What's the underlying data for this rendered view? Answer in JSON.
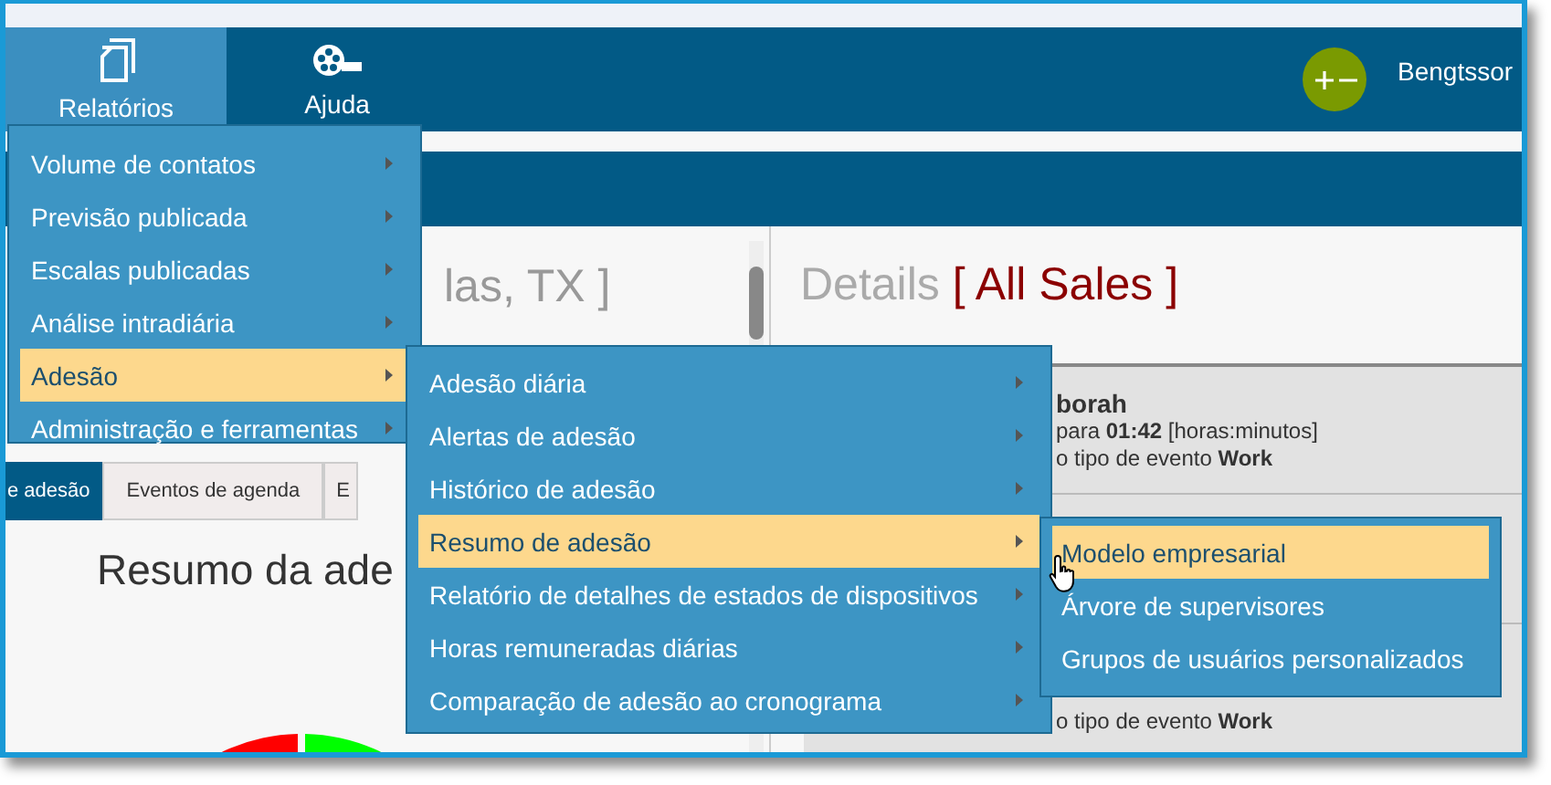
{
  "header": {
    "nav": [
      {
        "label": "Relatórios",
        "selected": true
      },
      {
        "label": "Ajuda",
        "selected": false
      }
    ],
    "user": "Bengtssor"
  },
  "left_panel": {
    "title_fragment": "las, TX ]",
    "tabs": [
      {
        "label": "e adesão",
        "selected": true
      },
      {
        "label": "Eventos de agenda",
        "selected": false
      },
      {
        "label": "E",
        "selected": false
      }
    ],
    "heading": "Resumo da ade"
  },
  "right_panel": {
    "title": "Details",
    "filter": "[ All Sales ]",
    "cards": [
      {
        "lines": [
          "borah",
          "para **01:42** [horas:minutos]",
          "o tipo de evento **Work**"
        ]
      },
      {
        "lines": [
          "o tipo de evento **Work**"
        ]
      }
    ]
  },
  "menu": {
    "items": [
      {
        "label": "Volume de contatos",
        "arrow": true,
        "selected": false
      },
      {
        "label": "Previsão publicada",
        "arrow": true,
        "selected": false
      },
      {
        "label": "Escalas publicadas",
        "arrow": true,
        "selected": false
      },
      {
        "label": "Análise intradiária",
        "arrow": true,
        "selected": false
      },
      {
        "label": "Adesão",
        "arrow": true,
        "selected": true,
        "children": [
          {
            "label": "Adesão diária",
            "arrow": true,
            "selected": false
          },
          {
            "label": "Alertas de adesão",
            "arrow": true,
            "selected": false
          },
          {
            "label": "Histórico de adesão",
            "arrow": true,
            "selected": false
          },
          {
            "label": "Resumo de adesão",
            "arrow": true,
            "selected": true,
            "children": [
              {
                "label": "Modelo empresarial",
                "arrow": false,
                "selected": true
              },
              {
                "label": "Árvore de supervisores",
                "arrow": false,
                "selected": false
              },
              {
                "label": "Grupos de usuários personalizados",
                "arrow": false,
                "selected": false
              }
            ]
          },
          {
            "label": "Relatório de detalhes de estados de dispositivos",
            "arrow": true,
            "selected": false
          },
          {
            "label": "Horas remuneradas diárias",
            "arrow": true,
            "selected": false
          },
          {
            "label": "Comparação de adesão ao cronograma",
            "arrow": true,
            "selected": false
          }
        ]
      },
      {
        "label": "Administração e ferramentas",
        "arrow": true,
        "selected": false
      }
    ]
  }
}
